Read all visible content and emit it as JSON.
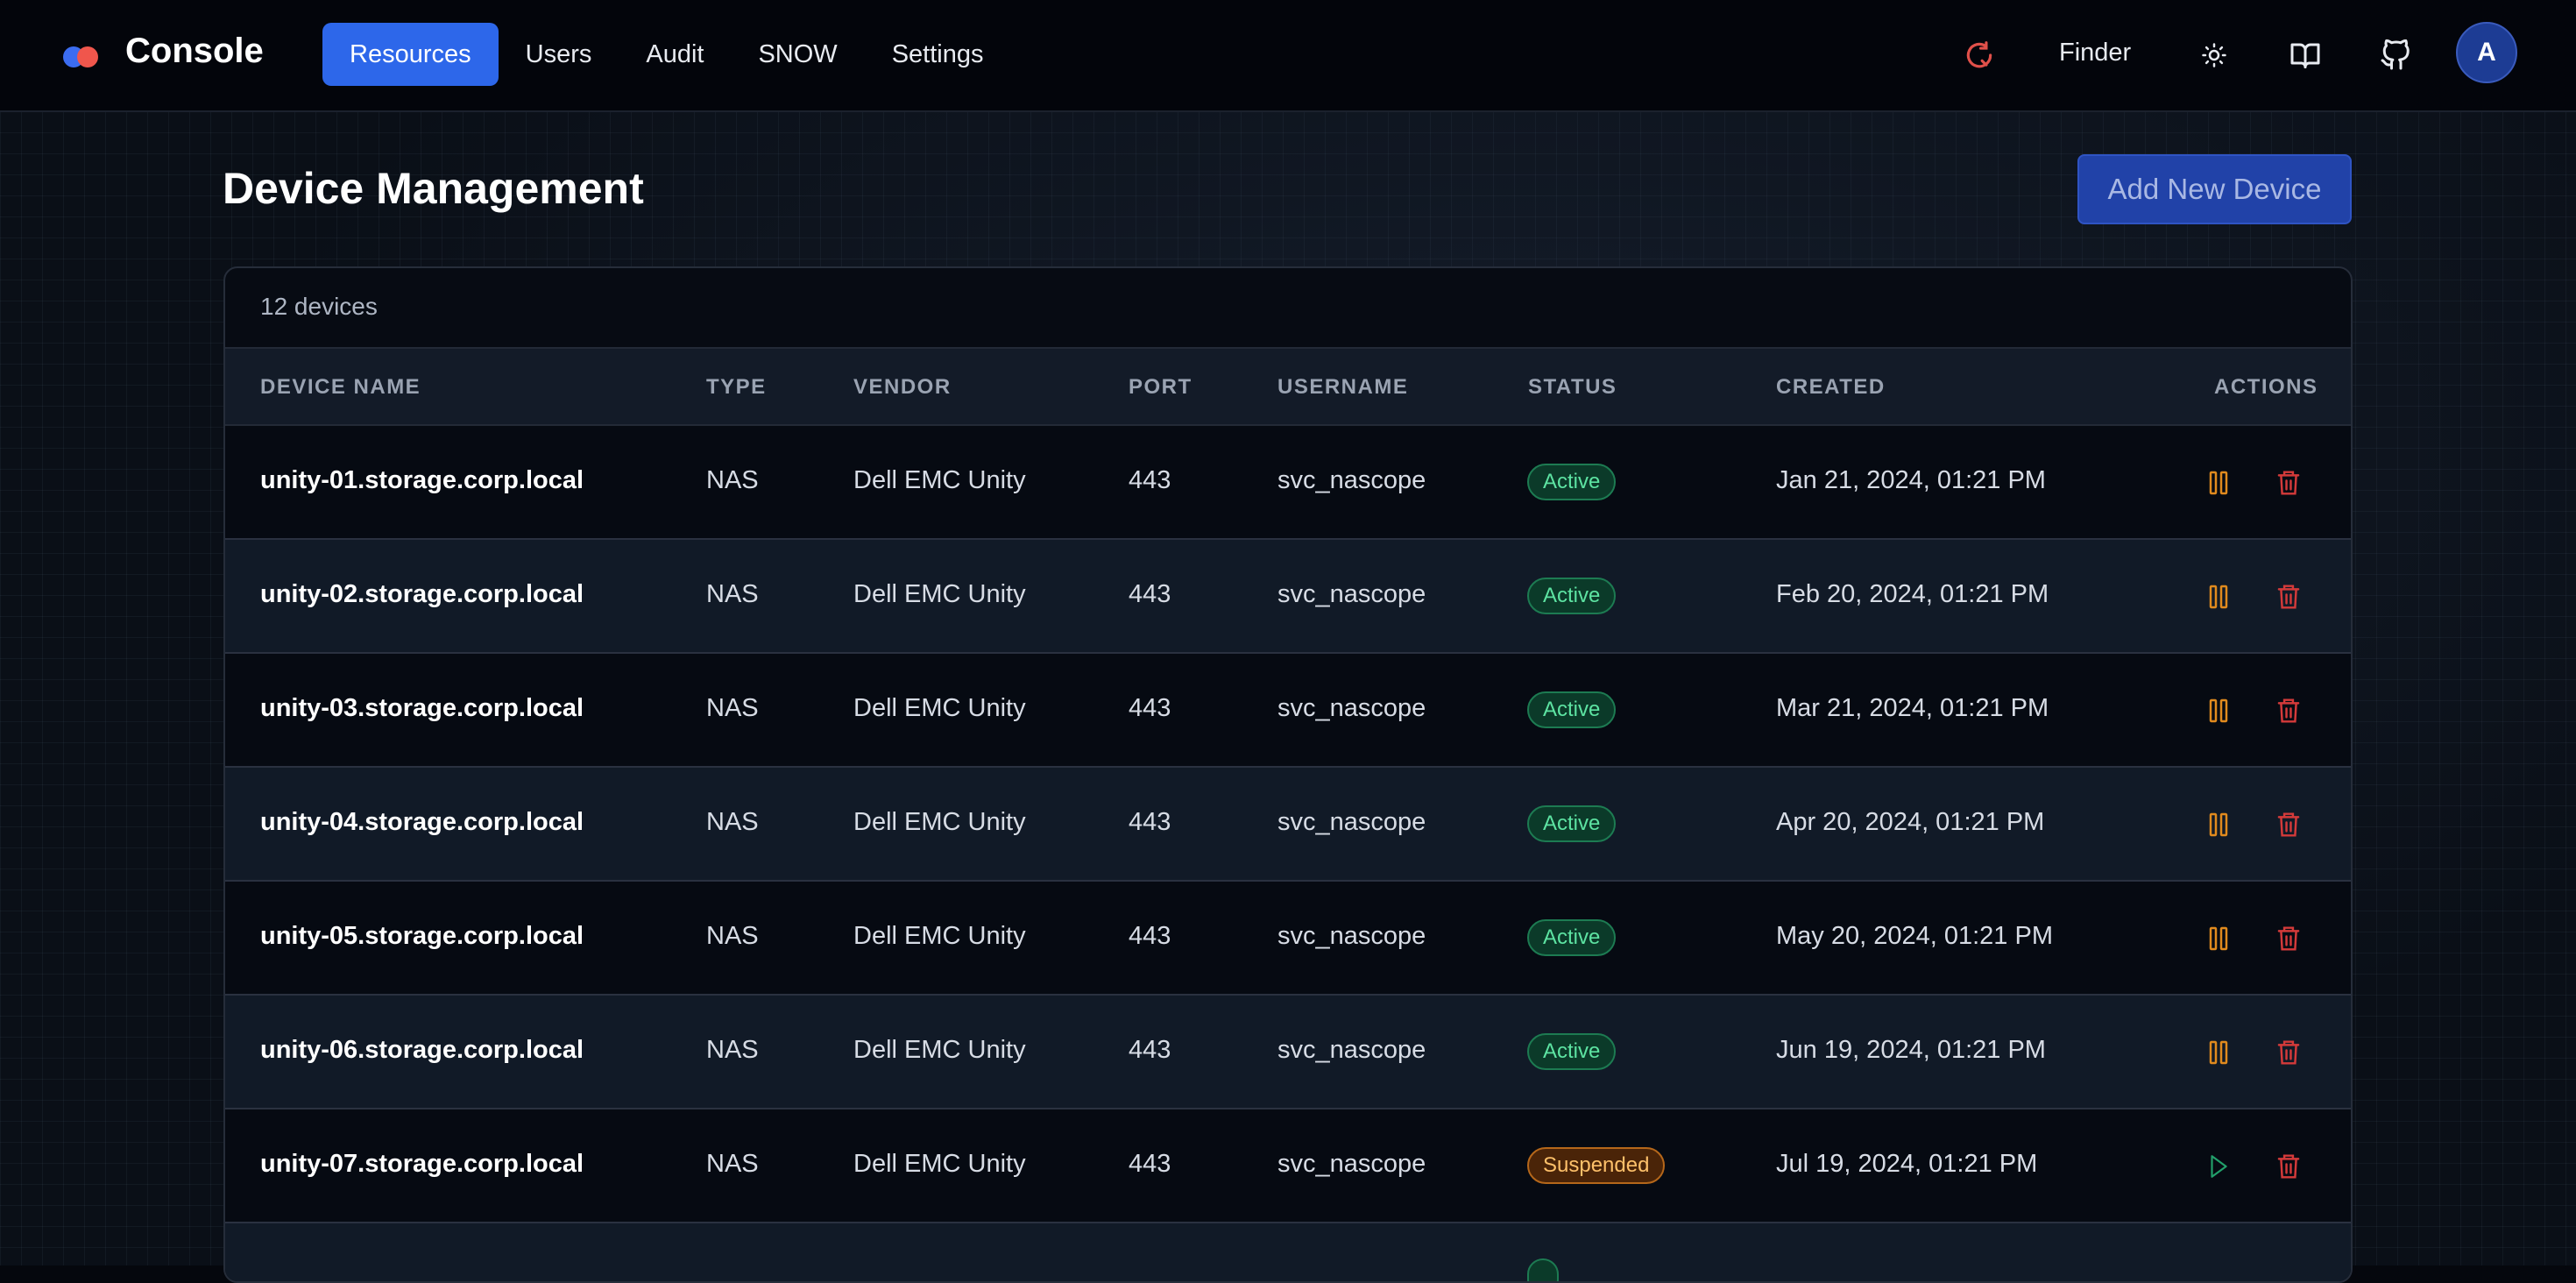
{
  "nav": {
    "brand": "Console",
    "tabs": [
      {
        "label": "Resources",
        "active": true
      },
      {
        "label": "Users",
        "active": false
      },
      {
        "label": "Audit",
        "active": false
      },
      {
        "label": "SNOW",
        "active": false
      },
      {
        "label": "Settings",
        "active": false
      }
    ],
    "finder_label": "Finder",
    "avatar_initial": "A",
    "icons": [
      "sync-icon",
      "sun-icon",
      "book-icon",
      "github-icon"
    ]
  },
  "page": {
    "title": "Device Management",
    "add_button": "Add New Device"
  },
  "table": {
    "count_label": "12 devices",
    "headers": [
      "DEVICE NAME",
      "TYPE",
      "VENDOR",
      "PORT",
      "USERNAME",
      "STATUS",
      "CREATED",
      "ACTIONS"
    ],
    "rows": [
      {
        "name": "unity-01.storage.corp.local",
        "type": "NAS",
        "vendor": "Dell EMC Unity",
        "port": "443",
        "username": "svc_nascope",
        "status": "Active",
        "created": "Jan 21, 2024, 01:21 PM"
      },
      {
        "name": "unity-02.storage.corp.local",
        "type": "NAS",
        "vendor": "Dell EMC Unity",
        "port": "443",
        "username": "svc_nascope",
        "status": "Active",
        "created": "Feb 20, 2024, 01:21 PM"
      },
      {
        "name": "unity-03.storage.corp.local",
        "type": "NAS",
        "vendor": "Dell EMC Unity",
        "port": "443",
        "username": "svc_nascope",
        "status": "Active",
        "created": "Mar 21, 2024, 01:21 PM"
      },
      {
        "name": "unity-04.storage.corp.local",
        "type": "NAS",
        "vendor": "Dell EMC Unity",
        "port": "443",
        "username": "svc_nascope",
        "status": "Active",
        "created": "Apr 20, 2024, 01:21 PM"
      },
      {
        "name": "unity-05.storage.corp.local",
        "type": "NAS",
        "vendor": "Dell EMC Unity",
        "port": "443",
        "username": "svc_nascope",
        "status": "Active",
        "created": "May 20, 2024, 01:21 PM"
      },
      {
        "name": "unity-06.storage.corp.local",
        "type": "NAS",
        "vendor": "Dell EMC Unity",
        "port": "443",
        "username": "svc_nascope",
        "status": "Active",
        "created": "Jun 19, 2024, 01:21 PM"
      },
      {
        "name": "unity-07.storage.corp.local",
        "type": "NAS",
        "vendor": "Dell EMC Unity",
        "port": "443",
        "username": "svc_nascope",
        "status": "Suspended",
        "created": "Jul 19, 2024, 01:21 PM"
      }
    ]
  },
  "colors": {
    "accent": "#2d67ea",
    "active_badge": "#5de3a2",
    "suspended_badge": "#fdc06a",
    "pause_icon": "#e08a1e",
    "delete_icon": "#d43a3a",
    "resume_icon": "#22a06b"
  }
}
